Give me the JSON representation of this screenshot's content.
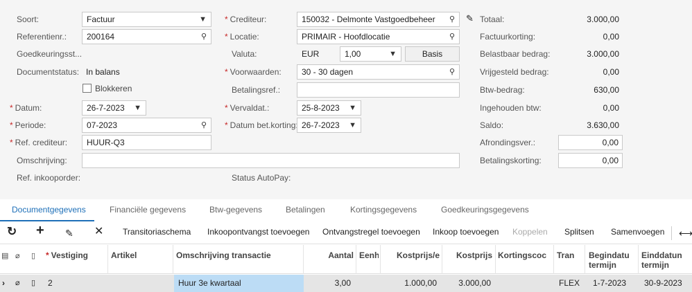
{
  "form": {
    "soort": {
      "label": "Soort:",
      "value": "Factuur"
    },
    "referentienr": {
      "label": "Referentienr.:",
      "value": "200164"
    },
    "goedkeuring": {
      "label": "Goedkeuringsst..."
    },
    "documentstatus": {
      "label": "Documentstatus:",
      "value": "In balans"
    },
    "blokkeren": {
      "label": "Blokkeren"
    },
    "datum": {
      "label": "Datum:",
      "value": "26-7-2023"
    },
    "periode": {
      "label": "Periode:",
      "value": "07-2023"
    },
    "ref_crediteur": {
      "label": "Ref. crediteur:",
      "value": "HUUR-Q3"
    },
    "omschrijving": {
      "label": "Omschrijving:",
      "value": ""
    },
    "ref_inkooporder": {
      "label": "Ref. inkooporder:"
    },
    "crediteur": {
      "label": "Crediteur:",
      "value": "150032 - Delmonte Vastgoedbeheer"
    },
    "locatie": {
      "label": "Locatie:",
      "value": "PRIMAIR - Hoofdlocatie"
    },
    "valuta": {
      "label": "Valuta:",
      "currency": "EUR",
      "rate": "1,00",
      "basis_button": "Basis"
    },
    "voorwaarden": {
      "label": "Voorwaarden:",
      "value": "30 - 30 dagen"
    },
    "betalingsref": {
      "label": "Betalingsref.:",
      "value": ""
    },
    "vervaldat": {
      "label": "Vervaldat.:",
      "value": "25-8-2023"
    },
    "datum_bet_korting": {
      "label": "Datum bet.korting:",
      "value": "26-7-2023"
    },
    "status_autopay": {
      "label": "Status AutoPay:"
    }
  },
  "totals": {
    "totaal": {
      "label": "Totaal:",
      "value": "3.000,00"
    },
    "factuurkorting": {
      "label": "Factuurkorting:",
      "value": "0,00"
    },
    "belastbaar": {
      "label": "Belastbaar bedrag:",
      "value": "3.000,00"
    },
    "vrijgesteld": {
      "label": "Vrijgesteld bedrag:",
      "value": "0,00"
    },
    "btw": {
      "label": "Btw-bedrag:",
      "value": "630,00"
    },
    "ingehouden": {
      "label": "Ingehouden btw:",
      "value": "0,00"
    },
    "saldo": {
      "label": "Saldo:",
      "value": "3.630,00"
    },
    "afronding": {
      "label": "Afrondingsver.:",
      "value": "0,00"
    },
    "betalingskorting": {
      "label": "Betalingskorting:",
      "value": "0,00"
    }
  },
  "tabs": [
    "Documentgegevens",
    "Financiële gegevens",
    "Btw-gegevens",
    "Betalingen",
    "Kortingsgegevens",
    "Goedkeuringsgegevens"
  ],
  "toolbar": {
    "transitieschema": "Transitoriaschema",
    "inkoopontvangst": "Inkoopontvangst toevoegen",
    "ontvangstregel": "Ontvangstregel toevoegen",
    "inkoop": "Inkoop toevoegen",
    "koppelen": "Koppelen",
    "splitsen": "Splitsen",
    "samenvoegen": "Samenvoegen"
  },
  "grid": {
    "columns": {
      "vestiging": "Vestiging",
      "artikel": "Artikel",
      "omschrijving": "Omschrijving transactie",
      "aantal": "Aantal",
      "eenheid": "Eenh",
      "kostprijs_eenheid": "Kostprijs/e",
      "kostprijs": "Kostprijs",
      "kortingscode": "Kortingscoc",
      "tran": "Tran",
      "begindatum_1": "Begindatu",
      "begindatum_2": "termijn",
      "einddatum_1": "Einddatun",
      "einddatum_2": "termijn"
    },
    "rows": [
      {
        "vestiging": "2",
        "artikel": "",
        "omschrijving": "Huur 3e kwartaal",
        "aantal": "3,00",
        "eenheid": "",
        "kostprijs_eenheid": "1.000,00",
        "kostprijs": "3.000,00",
        "kortingscode": "",
        "tran": "FLEX",
        "begindatum": "1-7-2023",
        "einddatum": "30-9-2023"
      }
    ]
  }
}
